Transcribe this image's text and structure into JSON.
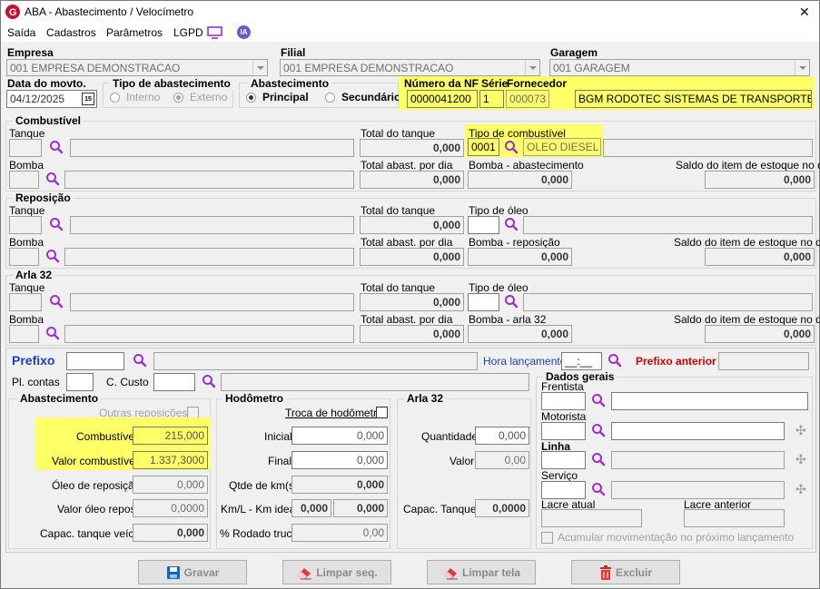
{
  "window": {
    "title": "ABA - Abastecimento / Velocímetro",
    "close": "✕"
  },
  "menu": {
    "saida": "Saída",
    "cadastros": "Cadastros",
    "parametros": "Parâmetros",
    "lgpd": "LGPD",
    "ia": "IA"
  },
  "header": {
    "empresa_label": "Empresa",
    "empresa_value": "001 EMPRESA DEMONSTRACAO",
    "filial_label": "Filial",
    "filial_value": "001 EMPRESA DEMONSTRACAO",
    "garagem_label": "Garagem",
    "garagem_value": "001 GARAGEM",
    "data_label": "Data do movto.",
    "data_value": "04/12/2025",
    "cal_day": "15",
    "tipo_label": "Tipo de abastecimento",
    "interno": "Interno",
    "externo": "Externo",
    "abast_label": "Abastecimento",
    "principal": "Principal",
    "secundario": "Secundário",
    "nf_label": "Número da NF",
    "serie_label": "Série",
    "fornecedor_label": "Fornecedor",
    "nf_value": "0000041200",
    "serie_value": "1",
    "fornecedor_code": "000073",
    "fornecedor_name": "BGM RODOTEC SISTEMAS DE TRANSPORTE"
  },
  "combustivel": {
    "title": "Combustível",
    "tanque": "Tanque",
    "bomba": "Bomba",
    "total_tanque": "Total do tanque",
    "total_tanque_value": "0,000",
    "total_abast": "Total abast. por dia",
    "total_abast_value": "0,000",
    "tipo_label": "Tipo de combustível",
    "tipo_code": "0001",
    "tipo_name": "OLEO DIESEL",
    "bomba_abast": "Bomba - abastecimento",
    "bomba_abast_value": "0,000",
    "saldo": "Saldo do item de estoque no dia",
    "saldo_value": "0,000"
  },
  "reposicao": {
    "title": "Reposição",
    "tanque": "Tanque",
    "bomba": "Bomba",
    "total_tanque": "Total do tanque",
    "total_tanque_value": "0,000",
    "total_abast": "Total abast. por dia",
    "total_abast_value": "0,000",
    "tipo_label": "Tipo de óleo",
    "bomba_rep": "Bomba - reposição",
    "bomba_rep_value": "0,000",
    "saldo": "Saldo do item de estoque no dia",
    "saldo_value": "0,000"
  },
  "arla": {
    "title": "Arla 32",
    "tanque": "Tanque",
    "bomba": "Bomba",
    "total_tanque": "Total do tanque",
    "total_tanque_value": "0,000",
    "total_abast": "Total abast. por dia",
    "total_abast_value": "0,000",
    "tipo_label": "Tipo de óleo",
    "bomba_arla": "Bomba - arla 32",
    "bomba_arla_value": "0,000",
    "saldo": "Saldo do item de estoque no dia",
    "saldo_value": "0,000"
  },
  "lower": {
    "prefixo": "Prefixo",
    "hora": "Hora lançamento",
    "hora_value": "__:__",
    "prefixo_ant": "Prefixo anterior",
    "pl_contas": "Pl. contas",
    "c_custo": "C. Custo"
  },
  "abastecimento": {
    "title": "Abastecimento",
    "outras": "Outras reposições",
    "combustivel": "Combustível",
    "combustivel_value": "215,000",
    "valor_comb": "Valor combustível",
    "valor_comb_value": "1.337,3000",
    "oleo_rep": "Óleo de reposição",
    "oleo_rep_value": "0,000",
    "valor_oleo": "Valor óleo repos.",
    "valor_oleo_value": "0,0000",
    "capac": "Capac. tanque veíc.",
    "capac_value": "0,000"
  },
  "hodometro": {
    "title": "Hodômetro",
    "troca": "Troca de hodômetro",
    "inicial": "Inicial",
    "inicial_value": "0,000",
    "final": "Final",
    "final_value": "0,000",
    "qtde": "Qtde de km(s)",
    "qtde_value": "0,000",
    "kml": "Km/L - Km ideal",
    "kml_value1": "0,000",
    "kml_value2": "0,000",
    "rodado": "% Rodado truck",
    "rodado_value": "0,00"
  },
  "arla_box": {
    "title": "Arla 32",
    "quantidade": "Quantidade",
    "quantidade_value": "0,000",
    "valor": "Valor",
    "valor_value": "0,00",
    "capac": "Capac. Tanque",
    "capac_value": "0,0000"
  },
  "dados": {
    "title": "Dados gerais",
    "frentista": "Frentista",
    "motorista": "Motorista",
    "linha": "Linha",
    "servico": "Serviço",
    "lacre_atual": "Lacre atual",
    "lacre_anterior": "Lacre anterior",
    "acumular": "Acumular movimentação no próximo lançamento"
  },
  "buttons": {
    "gravar": "Gravar",
    "limpar_seq": "Limpar seq.",
    "limpar_tela": "Limpar tela",
    "excluir": "Excluir"
  },
  "colors": {
    "highlight": "#ffff66",
    "prefixo_blue": "#1a3fbf",
    "prefixo_red": "#cc0000",
    "icon_purple": "#9b30d0"
  }
}
